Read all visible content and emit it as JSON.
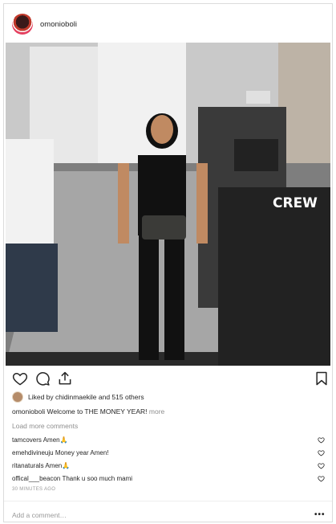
{
  "post": {
    "username": "omonioboli",
    "likes_by": "chidinmaekile",
    "likes_text": "Liked by chidinmaekile and 515 others",
    "caption_user": "omonioboli",
    "caption_text": "Welcome to THE MONEY YEAR!",
    "caption_more": "more",
    "load_more": "Load more comments",
    "shirt_text": "CREW",
    "comments": [
      {
        "user": "tamcovers",
        "text": "Amen🙏"
      },
      {
        "user": "emehdivineuju",
        "text": "Money year Amen!"
      },
      {
        "user": "ritanaturals",
        "text": "Amen🙏"
      },
      {
        "user": "offical___beacon",
        "text": "Thank u soo much mami"
      }
    ],
    "time": "30 MINUTES AGO",
    "add_comment_placeholder": "Add a comment…",
    "more_options": "•••"
  },
  "icons": {
    "like": "heart-icon",
    "comment": "comment-icon",
    "share": "share-icon",
    "save": "bookmark-icon",
    "comment_like": "heart-icon"
  }
}
